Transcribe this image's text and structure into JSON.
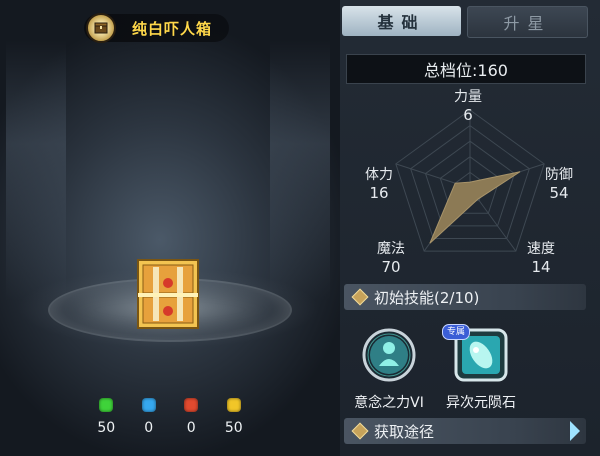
{
  "item": {
    "name": "纯白吓人箱",
    "icon": "treasure-chest-icon"
  },
  "gems": [
    {
      "color": "#3fd33a",
      "value": "50",
      "name": "green-gem-icon"
    },
    {
      "color": "#36a8ef",
      "value": "0",
      "name": "blue-gem-icon"
    },
    {
      "color": "#e24a2f",
      "value": "0",
      "name": "red-gem-icon"
    },
    {
      "color": "#f1c628",
      "value": "50",
      "name": "yellow-gem-icon"
    }
  ],
  "tabs": [
    {
      "label": "基础",
      "active": true
    },
    {
      "label": "升星",
      "active": false
    }
  ],
  "total_label": "总档位:160",
  "stats": {
    "power": {
      "label": "力量",
      "value": 6
    },
    "defense": {
      "label": "防御",
      "value": 54
    },
    "speed": {
      "label": "速度",
      "value": 14
    },
    "magic": {
      "label": "魔法",
      "value": 70
    },
    "stamina": {
      "label": "体力",
      "value": 16
    }
  },
  "skills_section": {
    "title": "初始技能(2/10)"
  },
  "skills": [
    {
      "label": "意念之力VI",
      "icon": "mind-power-skill-icon",
      "badge": ""
    },
    {
      "label": "异次元陨石",
      "icon": "dimension-meteor-skill-icon",
      "badge": "专属"
    }
  ],
  "acquire_section": {
    "title": "获取途径"
  },
  "colors": {
    "gold_text": "#ffd84a",
    "radar_fill": "#8c7a55",
    "accent_arrow": "#9fe3ff"
  }
}
